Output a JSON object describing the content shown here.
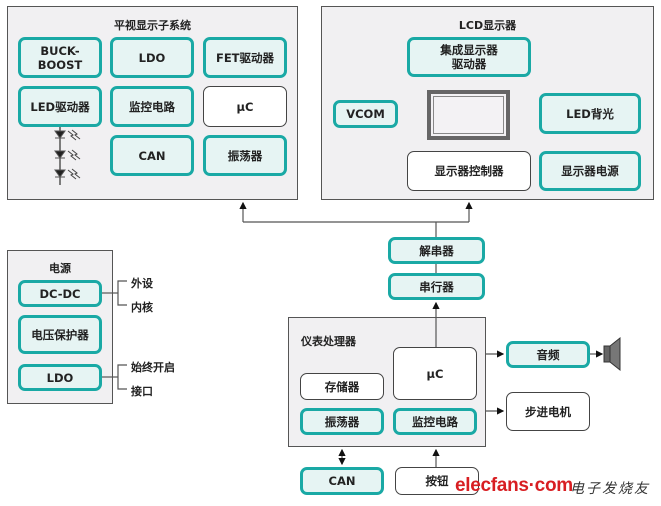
{
  "hud": {
    "title": "平视显示子系统",
    "blocks": [
      "BUCK-\nBOOST",
      "LDO",
      "FET驱动器",
      "LED驱动器",
      "监控电路",
      "μC",
      "CAN",
      "振荡器"
    ]
  },
  "lcd": {
    "title": "LCD显示器",
    "driver": "集成显示器\n驱动器",
    "vcom": "VCOM",
    "backlight": "LED背光",
    "controller": "显示器控制器",
    "power": "显示器电源"
  },
  "power": {
    "title": "电源",
    "dcdc": "DC-DC",
    "protect": "电压保护器",
    "ldo": "LDO",
    "outputs": [
      "外设",
      "内核",
      "始终开启",
      "接口"
    ]
  },
  "link": {
    "deserializer": "解串器",
    "serializer": "串行器"
  },
  "processor": {
    "title": "仪表处理器",
    "uc": "μC",
    "memory": "存储器",
    "oscillator": "振荡器",
    "monitor": "监控电路"
  },
  "external": {
    "audio": "音频",
    "stepper": "步进电机",
    "can": "CAN",
    "button": "按钮"
  },
  "watermark": {
    "logo": "elecfans·com",
    "cn": "电子发烧友"
  },
  "colors": {
    "accent": "#1aa9a5",
    "accent_fill": "#e6f4f3",
    "panel": "#f1f0f2",
    "logo": "#d81e22"
  }
}
